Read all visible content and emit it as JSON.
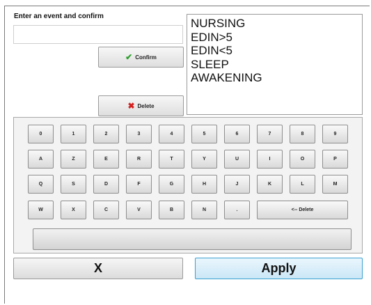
{
  "prompt": "Enter an event and confirm",
  "input": {
    "value": "",
    "placeholder": ""
  },
  "buttons": {
    "confirm_label": "Confirm",
    "confirm_icon": "check-icon",
    "delete_label": "Delete",
    "delete_icon": "x-icon"
  },
  "events": [
    "NURSING",
    "EDIN>5",
    "EDIN<5",
    "SLEEP",
    "AWAKENING"
  ],
  "keyboard": {
    "rows": [
      [
        "0",
        "1",
        "2",
        "3",
        "4",
        "5",
        "6",
        "7",
        "8",
        "9"
      ],
      [
        "A",
        "Z",
        "E",
        "R",
        "T",
        "Y",
        "U",
        "I",
        "O",
        "P"
      ],
      [
        "Q",
        "S",
        "D",
        "F",
        "G",
        "H",
        "J",
        "K",
        "L",
        "M"
      ],
      [
        "W",
        "X",
        "C",
        "V",
        "B",
        "N",
        "."
      ]
    ],
    "backspace_label": "<-- Delete"
  },
  "actions": {
    "cancel_label": "X",
    "apply_label": "Apply"
  },
  "colors": {
    "apply_border": "#3aa0d0",
    "apply_bg": "#cbe7f7",
    "check": "#2e9e2e",
    "cross": "#d42020"
  }
}
